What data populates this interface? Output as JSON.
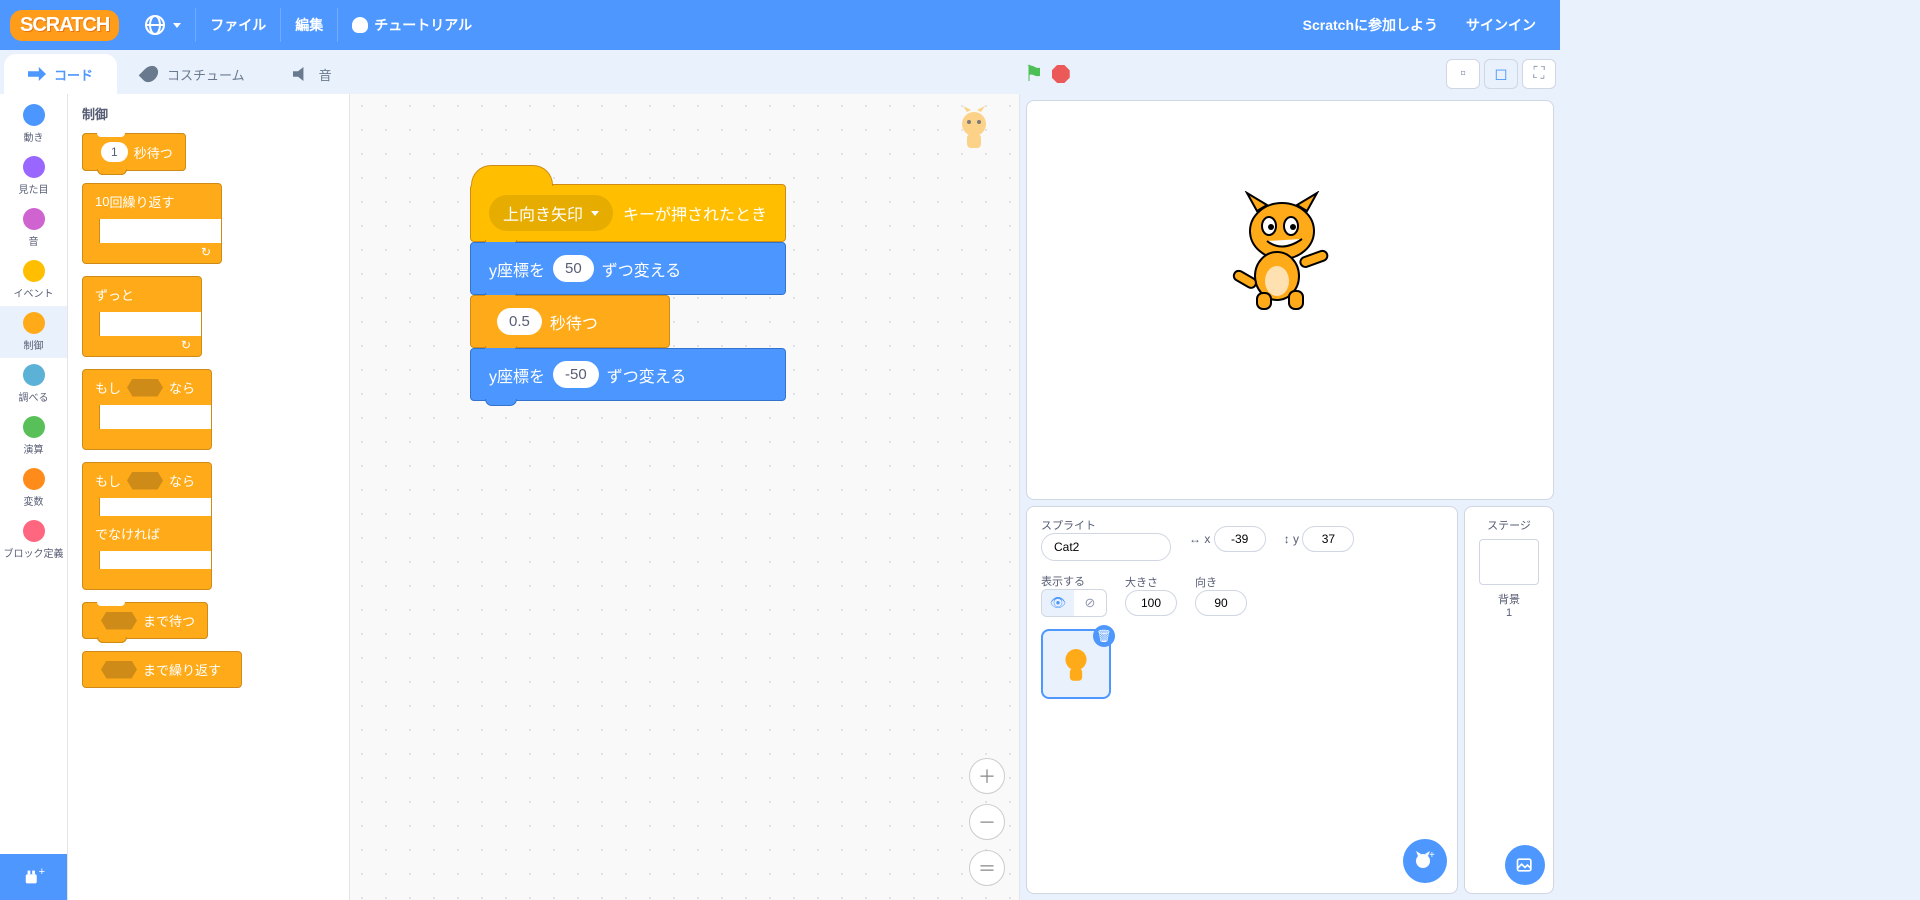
{
  "menubar": {
    "logo": "SCRATCH",
    "file": "ファイル",
    "edit": "編集",
    "tutorials": "チュートリアル",
    "join": "Scratchに参加しよう",
    "signin": "サインイン"
  },
  "tabs": {
    "code": "コード",
    "costumes": "コスチューム",
    "sounds": "音"
  },
  "categories": [
    {
      "name": "動き",
      "color": "#4c97ff"
    },
    {
      "name": "見た目",
      "color": "#9966ff"
    },
    {
      "name": "音",
      "color": "#cf63cf"
    },
    {
      "name": "イベント",
      "color": "#ffbf00"
    },
    {
      "name": "制御",
      "color": "#ffab19"
    },
    {
      "name": "調べる",
      "color": "#5cb1d6"
    },
    {
      "name": "演算",
      "color": "#59c059"
    },
    {
      "name": "変数",
      "color": "#ff8c1a"
    },
    {
      "name": "ブロック定義",
      "color": "#ff6680"
    }
  ],
  "palette": {
    "heading": "制御",
    "wait_label_before": "",
    "wait_value": "1",
    "wait_label_after": "秒待つ",
    "repeat_value": "10",
    "repeat_label": "回繰り返す",
    "forever_label": "ずっと",
    "if_before": "もし",
    "if_after": "なら",
    "else_label": "でなければ",
    "wait_until": "まで待つ",
    "repeat_until": "まで繰り返す"
  },
  "script": {
    "hat_key": "上向き矢印",
    "hat_label": "キーが押されたとき",
    "b1_before": "y座標を",
    "b1_val": "50",
    "b1_after": "ずつ変える",
    "b2_val": "0.5",
    "b2_after": "秒待つ",
    "b3_before": "y座標を",
    "b3_val": "-50",
    "b3_after": "ずつ変える"
  },
  "sprite": {
    "label": "スプライト",
    "name": "Cat2",
    "x_label": "x",
    "x": "-39",
    "y_label": "y",
    "y": "37",
    "show_label": "表示する",
    "size_label": "大きさ",
    "size": "100",
    "dir_label": "向き",
    "dir": "90"
  },
  "stage_panel": {
    "title": "ステージ",
    "backdrop_label": "背景",
    "backdrop_count": "1"
  }
}
